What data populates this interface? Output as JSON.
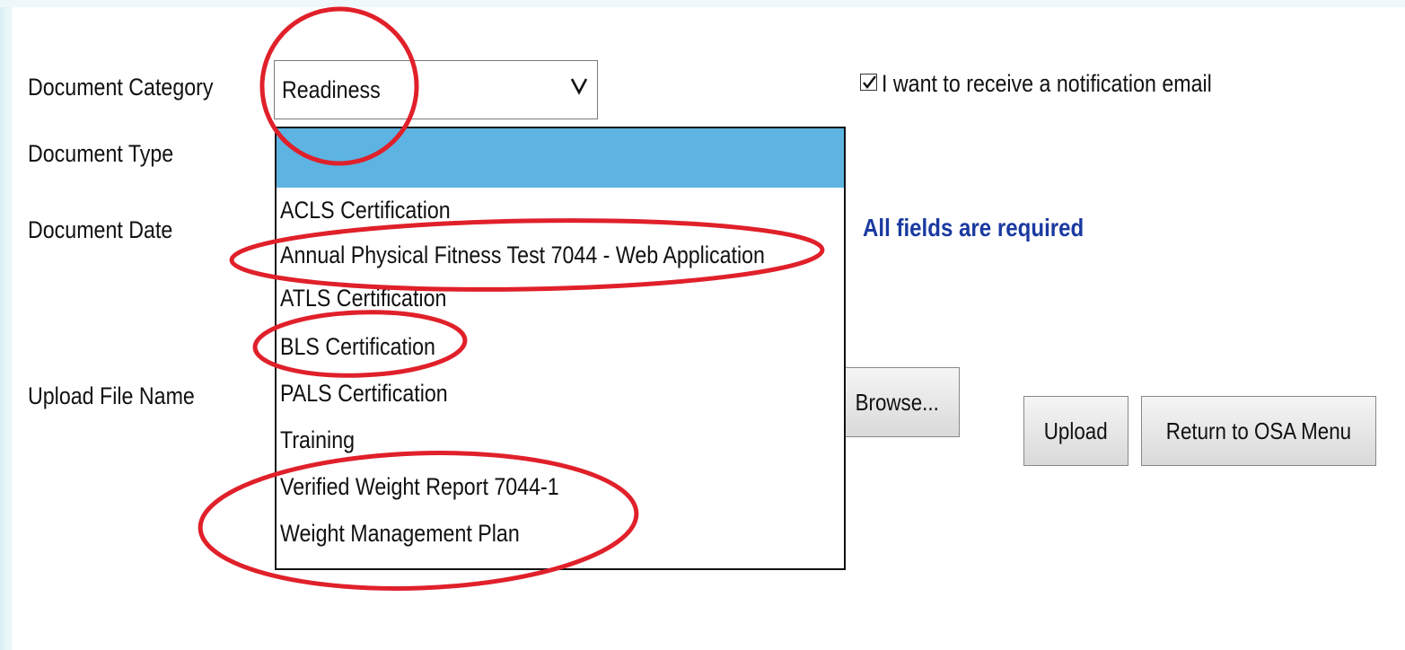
{
  "form": {
    "labels": {
      "category": "Document Category",
      "type": "Document Type",
      "date": "Document Date",
      "upload_file": "Upload File Name"
    },
    "category_select": {
      "value": "Readiness"
    },
    "type_dropdown": {
      "options": [
        "",
        "ACLS Certification",
        "Annual Physical Fitness Test 7044 - Web Application",
        "ATLS Certification",
        "BLS Certification",
        "PALS Certification",
        "Training",
        "Verified Weight Report 7044-1",
        "Weight Management Plan"
      ],
      "highlighted_index": 0
    },
    "notification": {
      "checked": true,
      "label": "I want to receive a notification email"
    },
    "required_notice": "All fields are required",
    "buttons": {
      "browse": "Browse...",
      "upload": "Upload",
      "return": "Return to OSA Menu"
    }
  },
  "colors": {
    "highlight": "#5db4e2",
    "required_text": "#1a3aa0",
    "annotation": "#e0202a"
  }
}
